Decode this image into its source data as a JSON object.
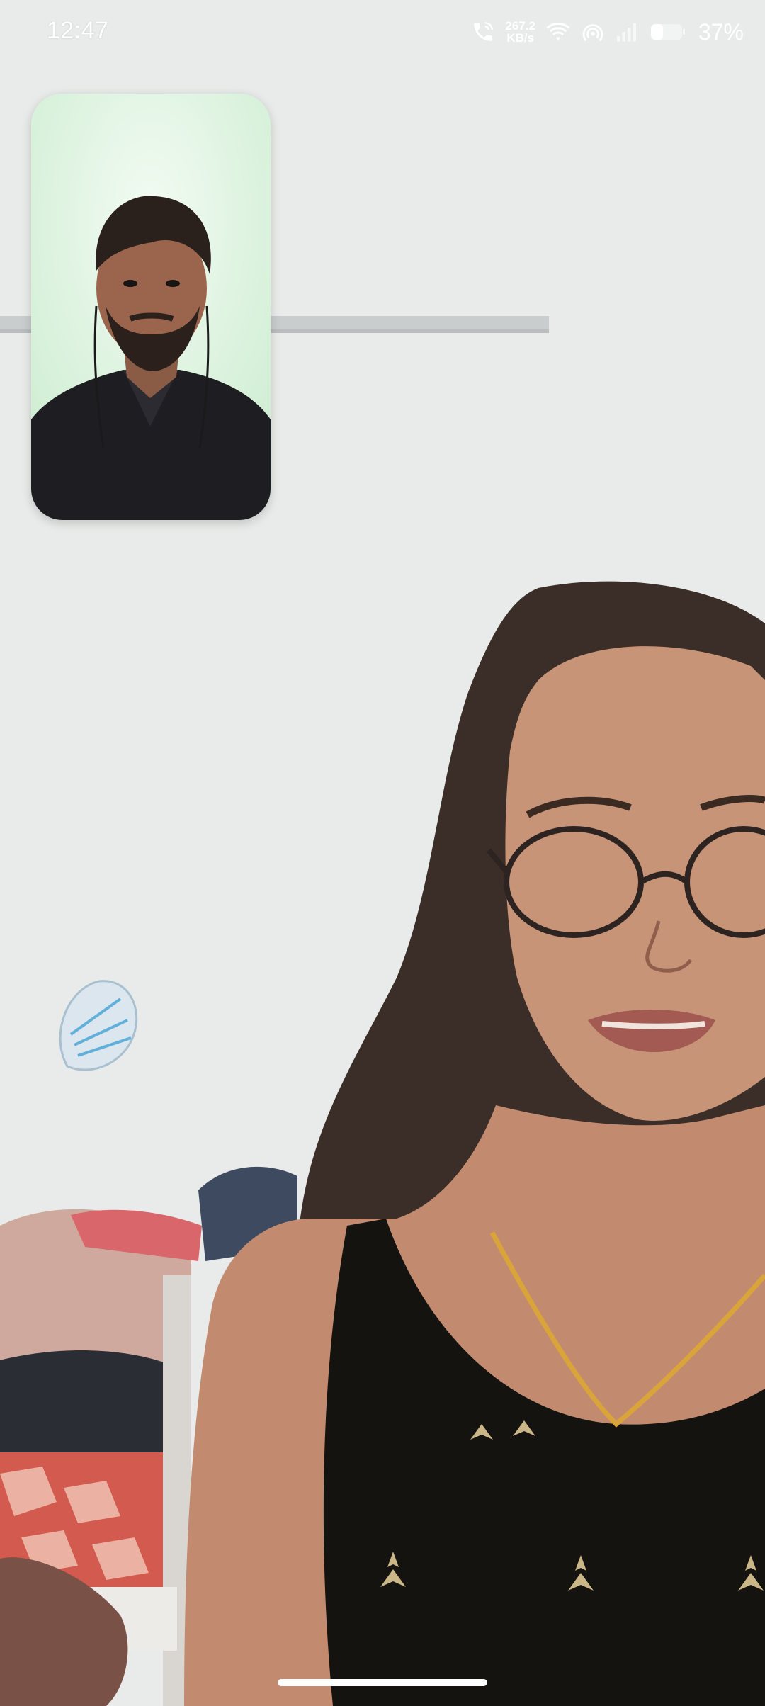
{
  "status_bar": {
    "time": "12:47",
    "net_speed_value": "267.2",
    "net_speed_unit": "KB/s",
    "battery_percent": "37%",
    "icons": [
      "phone-call-icon",
      "wifi-icon",
      "hotspot-icon",
      "signal-icon",
      "battery-icon"
    ]
  },
  "call": {
    "self_preview": {
      "label": "self-video-preview"
    },
    "remote_video": {
      "label": "remote-video-feed"
    }
  },
  "colors": {
    "status_text": "#ffffff",
    "wall": "#e9eceb",
    "self_preview_bg": "#dff2e2"
  }
}
